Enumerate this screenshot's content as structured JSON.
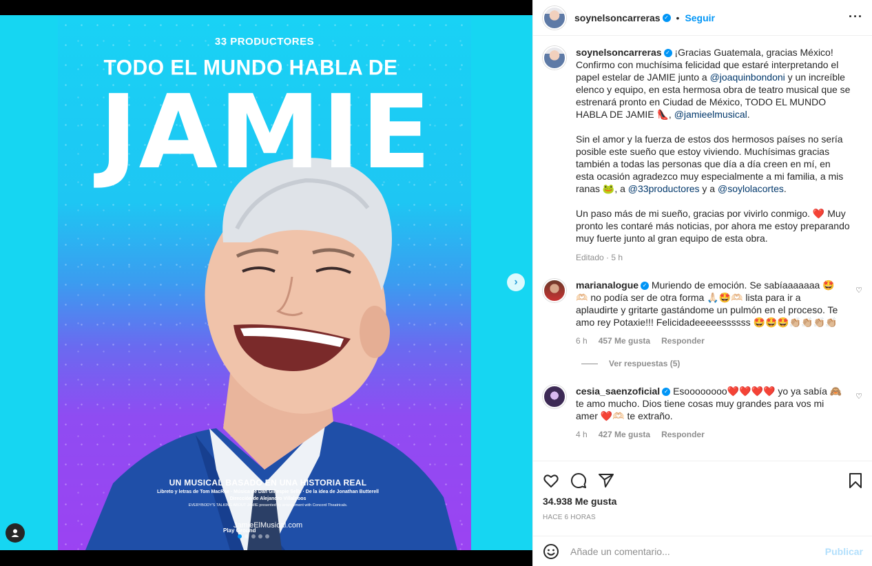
{
  "poster": {
    "producer": "33 PRODUCTORES",
    "headline": "TODO EL MUNDO HABLA DE",
    "title": "JAMIE",
    "subtitle": "UN MUSICAL BASADO EN UNA HISTORIA REAL",
    "credits_line1": "Libreto y letras de Tom MacRae · Música de Dan Gillespie Sells · De la idea de Jonathan Butterell",
    "credits_line2": "Dirección de Alejandro Villalobos",
    "credits_line3": "EVERYBODY'S TALKING ABOUT JAMIE presented by arrangement with Concord Theatricals.",
    "logos_text": "Play Ground",
    "website": "JamieElMusical.com"
  },
  "header": {
    "username": "soynelsoncarreras",
    "separator": "•",
    "follow_label": "Seguir",
    "more_label": "···"
  },
  "caption": {
    "username": "soynelsoncarreras",
    "p1_a": "¡Gracias Guatemala, gracias México! Confirmo con muchísima felicidad que estaré interpretando el papel estelar de JAMIE junto a ",
    "mention1": "@joaquinbondoni",
    "p1_b": " y un increíble elenco y equipo, en esta hermosa obra de teatro musical que se estrenará pronto en Ciudad de México, TODO EL MUNDO HABLA DE JAMIE 👠, ",
    "mention2": "@jamieelmusical",
    "p1_c": ".",
    "p2_a": "Sin el amor y la fuerza de estos dos hermosos países no sería posible este sueño que estoy viviendo. Muchísimas gracias también a todas las personas que día a día creen en mí, en esta ocasión agradezco muy especialmente a mi familia, a mis ranas 🐸, a ",
    "mention3": "@33productores",
    "p2_b": " y a ",
    "mention4": "@soylolacortes",
    "p2_c": ".",
    "p3": "Un paso más de mi sueño, gracias por vivirlo conmigo. ❤️ Muy pronto les contaré más noticias, por ahora me estoy preparando muy fuerte junto al gran equipo de esta obra.",
    "meta": "Editado · 5 h"
  },
  "comments": [
    {
      "username": "marianalogue",
      "text": "Muriendo de emoción. Se sabíaaaaaaa 🤩🫶🏻 no podía ser de otra forma 🙏🏻🤩🫶🏻 lista para ir a aplaudirte y gritarte gastándome un pulmón en el proceso. Te amo rey Potaxie!!! Felicidadeeeeessssss 🤩🤩🤩👏🏼👏🏼👏🏼👏🏼",
      "time": "6 h",
      "likes": "457 Me gusta",
      "reply_label": "Responder"
    },
    {
      "username": "cesia_saenzoficial",
      "text": "Esoooooooo❤️❤️❤️❤️ yo ya sabía 🙈 te amo mucho. Dios tiene cosas muy grandes para vos mi amer ❤️🫶🏻 te extraño.",
      "time": "4 h",
      "likes": "427 Me gusta",
      "reply_label": "Responder"
    }
  ],
  "view_replies": "Ver respuestas (5)",
  "actions": {
    "likes": "34.938 Me gusta",
    "time": "HACE 6 HORAS"
  },
  "add_comment": {
    "placeholder": "Añade un comentario...",
    "publish_label": "Publicar"
  },
  "colors": {
    "accent": "#0095f6",
    "poster_top": "#19d2f5",
    "poster_bottom": "#9b43f2"
  }
}
